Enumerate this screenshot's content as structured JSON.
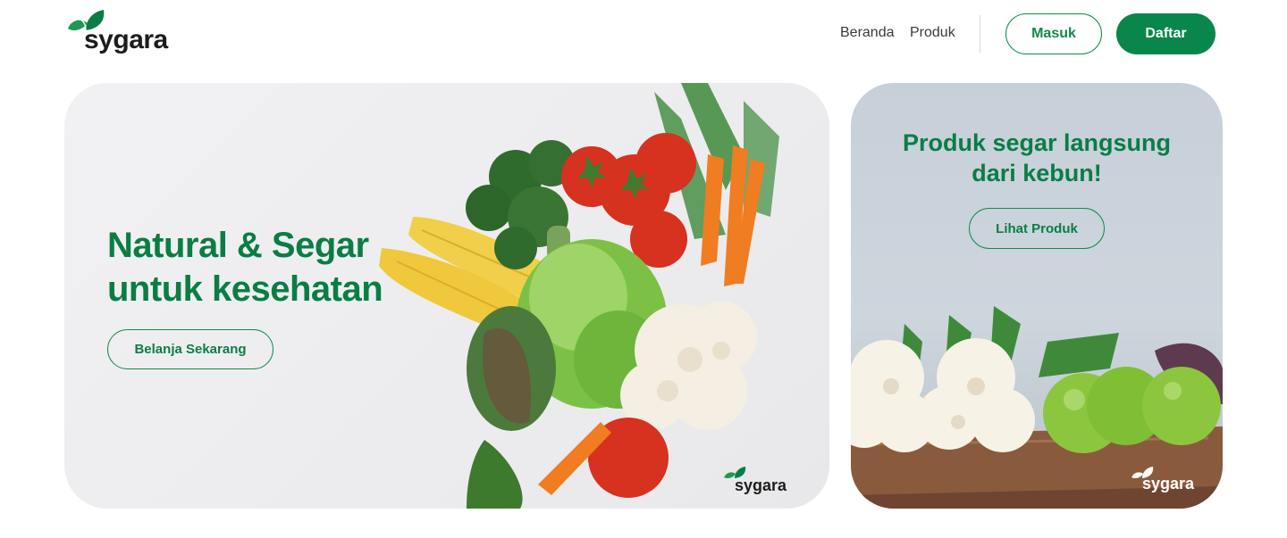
{
  "brand": {
    "name": "sygara",
    "color": "#0a7d45"
  },
  "nav": {
    "items": [
      "Beranda",
      "Produk"
    ]
  },
  "auth": {
    "login_label": "Masuk",
    "register_label": "Daftar"
  },
  "hero": {
    "title_line1": "Natural & Segar",
    "title_line2": "untuk kesehatan",
    "cta_label": "Belanja Sekarang",
    "image": "vegetables-flatlay",
    "watermark": "sygara"
  },
  "side_banner": {
    "title_line1": "Produk segar langsung",
    "title_line2": "dari kebun!",
    "cta_label": "Lihat Produk",
    "image": "cauliflower-tomatoes-tray",
    "watermark": "sygara"
  }
}
